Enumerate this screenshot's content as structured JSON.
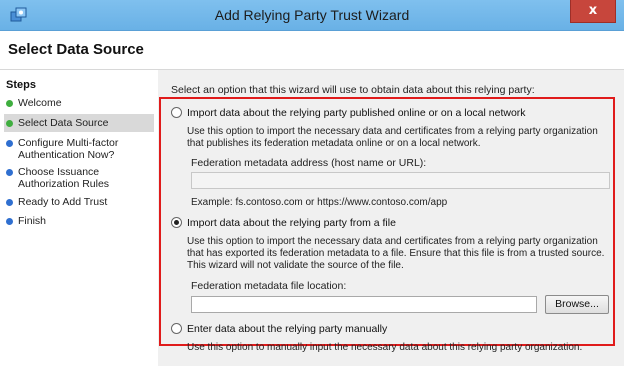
{
  "window": {
    "title": "Add Relying Party Trust Wizard",
    "close_label": "x"
  },
  "page_title": "Select Data Source",
  "sidebar": {
    "heading": "Steps",
    "items": [
      {
        "label": "Welcome",
        "state": "done"
      },
      {
        "label": "Select Data Source",
        "state": "current"
      },
      {
        "label": "Configure Multi-factor Authentication Now?",
        "state": "pending"
      },
      {
        "label": "Choose Issuance Authorization Rules",
        "state": "pending"
      },
      {
        "label": "Ready to Add Trust",
        "state": "pending"
      },
      {
        "label": "Finish",
        "state": "pending"
      }
    ]
  },
  "main": {
    "prompt": "Select an option that this wizard will use to obtain data about this relying party:",
    "options": [
      {
        "label": "Import data about the relying party published online or on a local network",
        "description": "Use this option to import the necessary data and certificates from a relying party organization that publishes its federation metadata online or on a local network.",
        "field_label": "Federation metadata address (host name or URL):",
        "field_value": "",
        "example": "Example: fs.contoso.com or https://www.contoso.com/app",
        "selected": false
      },
      {
        "label": "Import data about the relying party from a file",
        "description": "Use this option to import the necessary data and certificates from a relying party organization that has exported its federation metadata to a file. Ensure that this file is from a trusted source.  This wizard will not validate the source of the file.",
        "field_label": "Federation metadata file location:",
        "field_value": "",
        "browse_label": "Browse...",
        "selected": true
      },
      {
        "label": "Enter data about the relying party manually",
        "description": "Use this option to manually input the necessary data about this relying party organization.",
        "selected": false
      }
    ]
  },
  "colors": {
    "done_dot": "#3fae3f",
    "pending_dot": "#2f6fd0",
    "highlight_border": "#e01b1b",
    "titlebar": "#69b1e6",
    "close_button": "#c7463c"
  }
}
